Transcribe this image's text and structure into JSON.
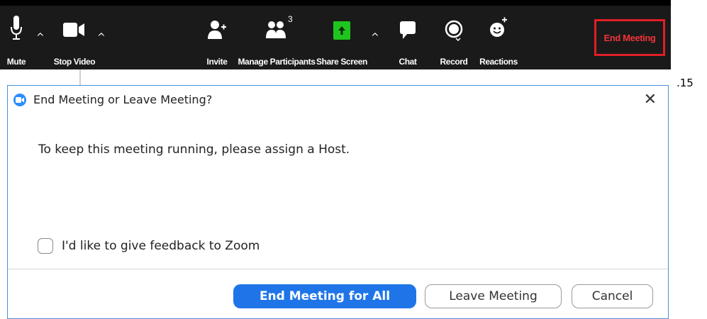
{
  "toolbar": {
    "mute_label": "Mute",
    "stop_video_label": "Stop Video",
    "invite_label": "Invite",
    "participants_label": "Manage Participants",
    "participants_count": "3",
    "share_label": "Share Screen",
    "chat_label": "Chat",
    "record_label": "Record",
    "reactions_label": "Reactions",
    "end_meeting_label": "End Meeting",
    "caret": "^",
    "accent_share": "#1ec51e",
    "end_highlight": "#e01e26"
  },
  "side_note": ".15",
  "dialog": {
    "title": "End Meeting or Leave Meeting?",
    "close_glyph": "✕",
    "message": "To keep this meeting running, please assign a Host.",
    "feedback_label": "I'd like to give feedback to Zoom",
    "feedback_checked": false,
    "buttons": {
      "end_all": "End Meeting for All",
      "leave": "Leave Meeting",
      "cancel": "Cancel"
    },
    "primary_color": "#1f75e8"
  }
}
